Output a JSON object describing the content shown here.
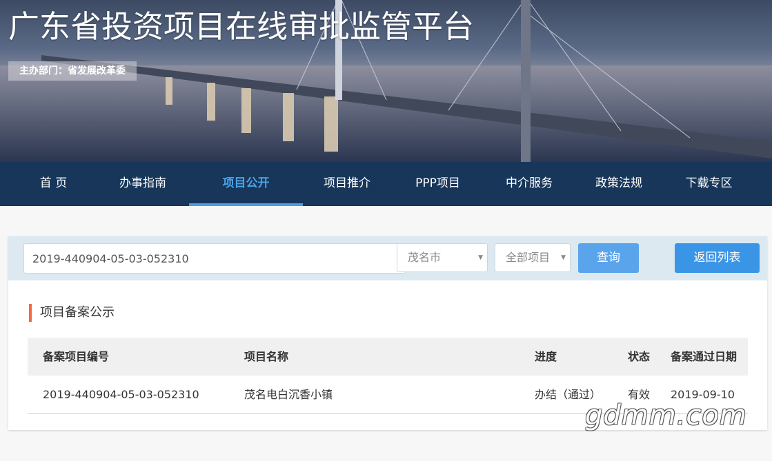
{
  "header": {
    "site_title": "广东省投资项目在线审批监管平台",
    "sponsor": "主办部门：省发展改革委"
  },
  "nav": {
    "items": [
      {
        "label": "首 页"
      },
      {
        "label": "办事指南"
      },
      {
        "label": "项目公开"
      },
      {
        "label": "项目推介"
      },
      {
        "label": "PPP项目"
      },
      {
        "label": "中介服务"
      },
      {
        "label": "政策法规"
      },
      {
        "label": "下载专区"
      }
    ],
    "active_index": 2
  },
  "search": {
    "input_value": "2019-440904-05-03-052310",
    "city_select": "茂名市",
    "type_select": "全部项目",
    "query_label": "查询",
    "back_label": "返回列表"
  },
  "section": {
    "title": "项目备案公示"
  },
  "table": {
    "headers": [
      "备案项目编号",
      "项目名称",
      "进度",
      "状态",
      "备案通过日期"
    ],
    "rows": [
      [
        "2019-440904-05-03-052310",
        "茂名电白沉香小镇",
        "办结（通过）",
        "有效",
        "2019-09-10"
      ]
    ]
  },
  "watermark": "gdmm.com",
  "colors": {
    "nav_bg": "#17365a",
    "nav_active": "#4aa3e8",
    "query_button": "#5aa4ec",
    "back_button": "#3b95e6",
    "section_accent": "#f36a3f"
  }
}
